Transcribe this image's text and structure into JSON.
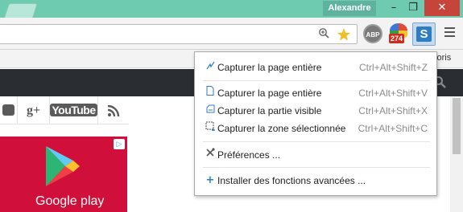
{
  "window": {
    "user_name": "Alexandre",
    "controls": {
      "minimize": "–",
      "maximize": "❐",
      "close": "✕"
    }
  },
  "toolbar": {
    "extensions": {
      "abp_label": "ABP",
      "badge_count": "274",
      "shutter_letter": "S"
    }
  },
  "bookmarks": {
    "favoris_label": "voris"
  },
  "menu": {
    "items": [
      {
        "label": "Capturer la page entière",
        "shortcut": "Ctrl+Alt+Shift+Z",
        "icon": "scribble-icon"
      },
      {
        "label": "Capturer la page entière",
        "shortcut": "Ctrl+Alt+Shift+V",
        "icon": "page-icon"
      },
      {
        "label": "Capturer la partie visible",
        "shortcut": "Ctrl+Alt+Shift+X",
        "icon": "visible-area-icon"
      },
      {
        "label": "Capturer la zone sélectionnée",
        "shortcut": "Ctrl+Alt+Shift+C",
        "icon": "selection-icon"
      },
      {
        "label": "Préférences ...",
        "shortcut": "",
        "icon": "tools-icon"
      },
      {
        "label": "Installer des fonctions avancées ...",
        "shortcut": "",
        "icon": "plus-icon"
      }
    ]
  },
  "page": {
    "social": {
      "gplus": "g+",
      "youtube": "YouTube"
    },
    "ad": {
      "brand": "Google play"
    }
  },
  "colors": {
    "titlebar": "#6fcbb0",
    "close_button": "#c7443a",
    "ad_background": "#d0103a",
    "shutter_accent": "#2f7dc1"
  }
}
